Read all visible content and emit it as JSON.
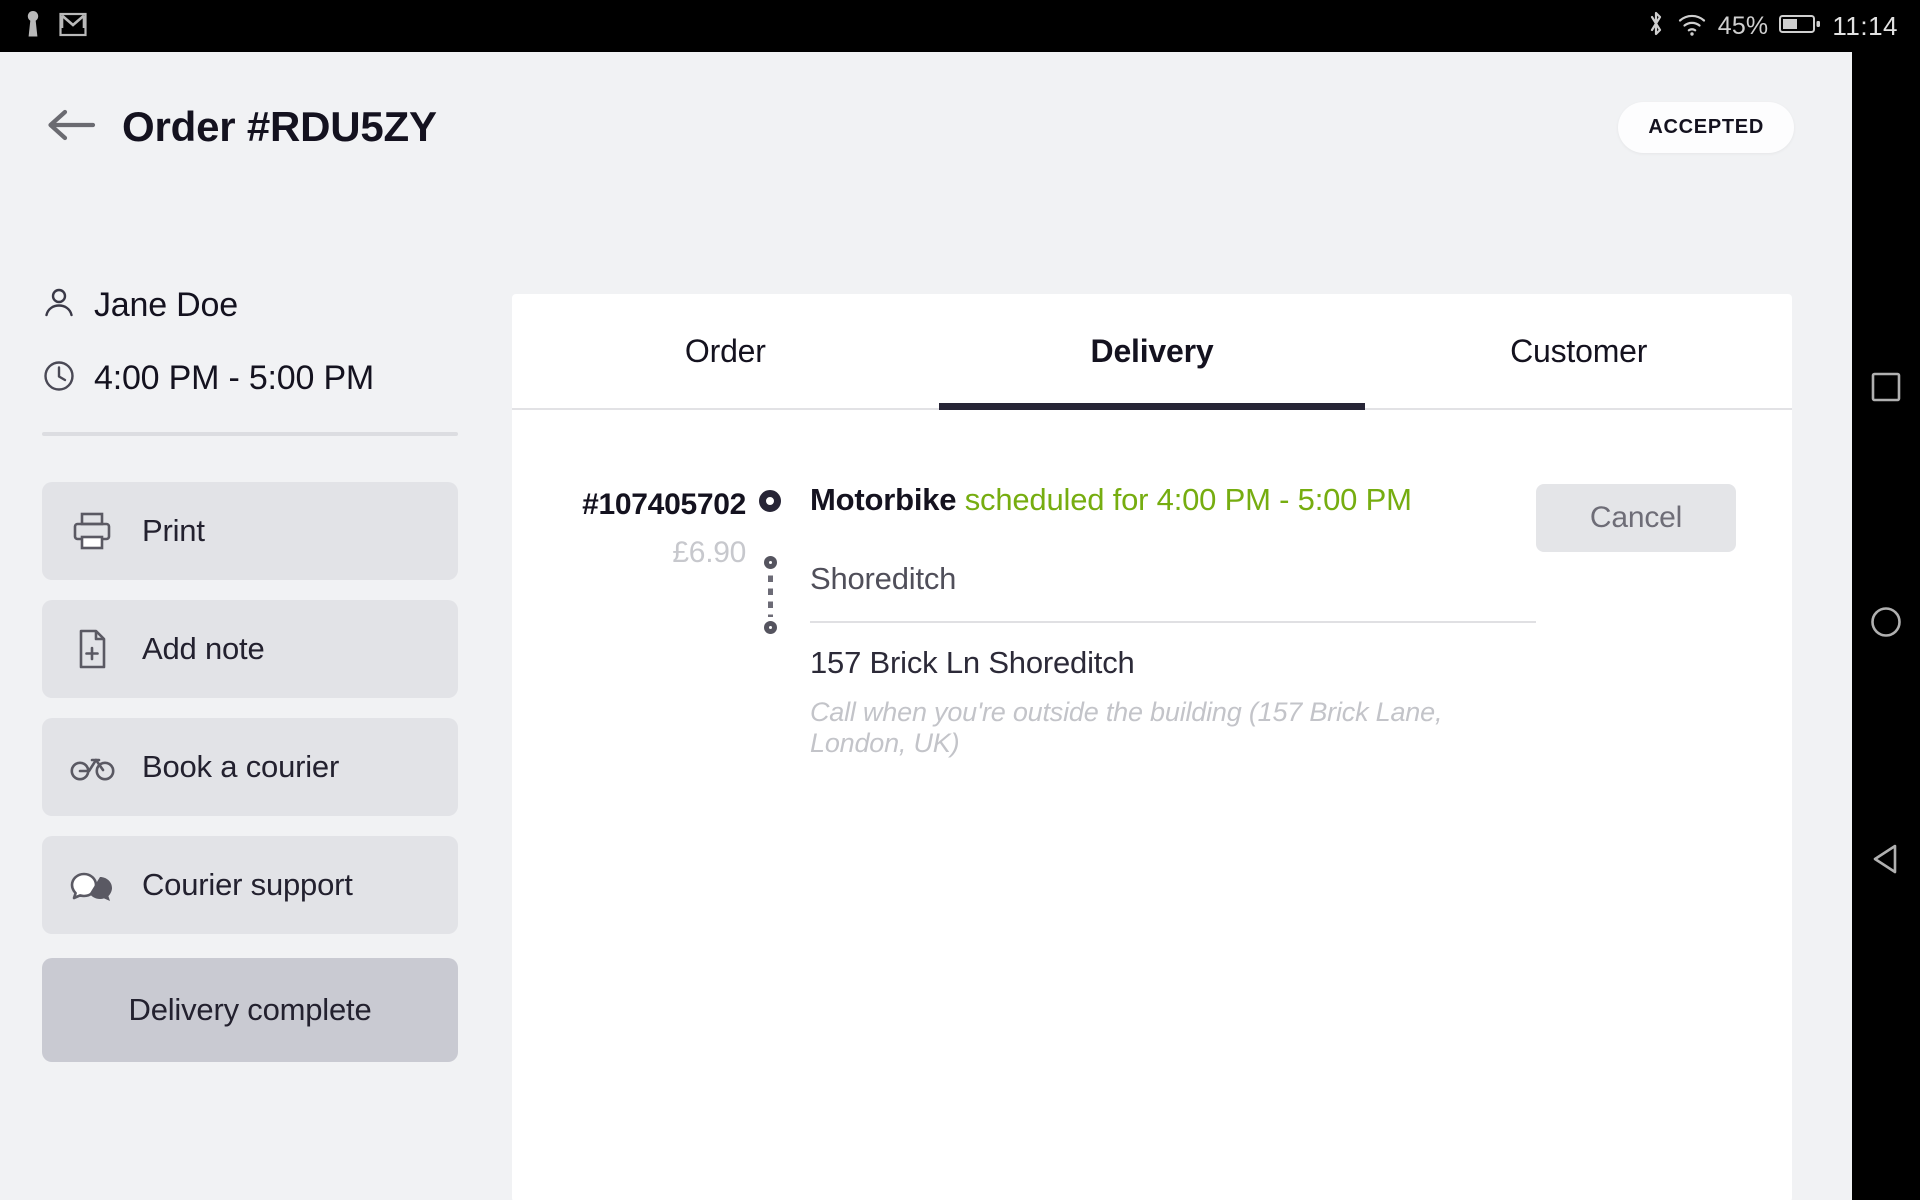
{
  "statusbar": {
    "left_icons": [
      "keyhole-icon",
      "gmail-icon"
    ],
    "bluetooth_icon": "bluetooth-icon",
    "wifi_icon": "wifi-icon",
    "battery_percent": "45%",
    "battery_icon": "battery-icon",
    "time": "11:14"
  },
  "navbar": {
    "recents_label": "recents",
    "home_label": "home",
    "back_label": "back"
  },
  "header": {
    "back_icon": "arrow-left-icon",
    "title": "Order #RDU5ZY",
    "status": "ACCEPTED"
  },
  "sidebar": {
    "customer_name": "Jane Doe",
    "time_window": "4:00 PM - 5:00 PM",
    "buttons": [
      {
        "label": "Print",
        "icon": "printer-icon"
      },
      {
        "label": "Add note",
        "icon": "note-add-icon"
      },
      {
        "label": "Book a courier",
        "icon": "bicycle-icon"
      },
      {
        "label": "Courier support",
        "icon": "chat-bubbles-icon"
      }
    ],
    "primary_button": "Delivery complete"
  },
  "tabs": [
    {
      "label": "Order",
      "active": false
    },
    {
      "label": "Delivery",
      "active": true
    },
    {
      "label": "Customer",
      "active": false
    }
  ],
  "delivery": {
    "id": "#107405702",
    "price": "£6.90",
    "vehicle": "Motorbike",
    "schedule": "scheduled for 4:00 PM - 5:00 PM",
    "pickup_address": "Shoreditch",
    "dropoff_address": "157  Brick Ln Shoreditch",
    "note": "Call when you're outside the building (157 Brick Lane, London, UK)",
    "cancel_label": "Cancel"
  },
  "colors": {
    "accent_green": "#76ad10",
    "dark": "#272536",
    "app_bg": "#f1f2f4",
    "button_bg": "#e2e3e7",
    "primary_button_bg": "#c9cad2"
  }
}
